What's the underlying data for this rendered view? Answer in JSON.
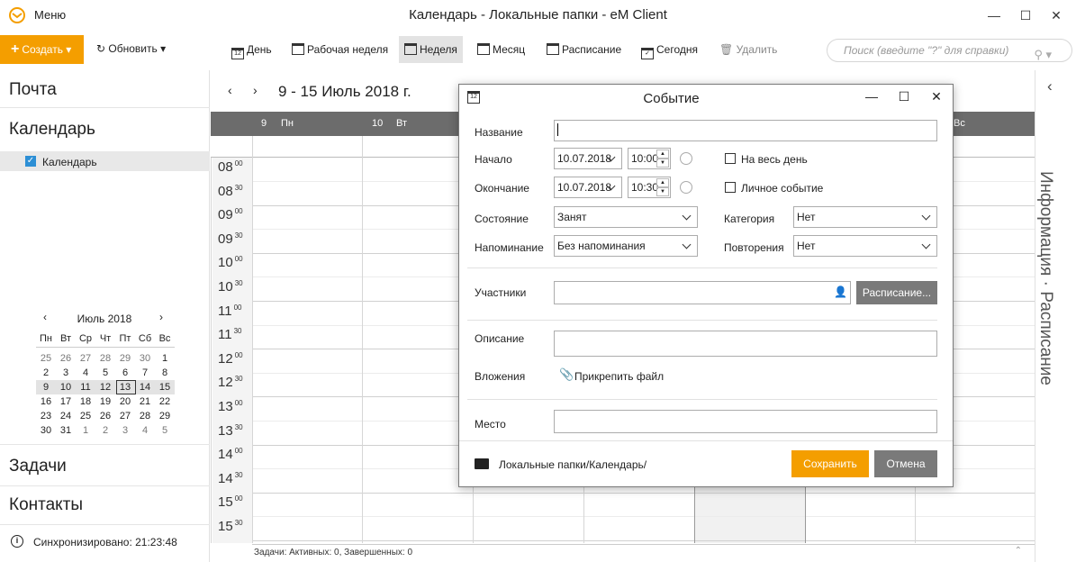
{
  "titlebar": {
    "menu": "Меню",
    "title": "Календарь - Локальные папки - eM Client",
    "min": "—",
    "max": "☐",
    "close": "✕"
  },
  "toolbar": {
    "create": "Создать",
    "refresh": "Обновить",
    "day": "День",
    "workweek": "Рабочая неделя",
    "week": "Неделя",
    "month": "Месяц",
    "schedule": "Расписание",
    "today": "Сегодня",
    "delete": "Удалить",
    "search_placeholder": "Поиск (введите \"?\" для справки)",
    "cal_icon_num": "12"
  },
  "sidebar": {
    "mail": "Почта",
    "calendar": "Календарь",
    "calendar_item": "Календарь",
    "tasks": "Задачи",
    "contacts": "Контакты",
    "sync": "Синхронизировано: 21:23:48"
  },
  "mini_calendar": {
    "title": "Июль 2018",
    "weekdays": [
      "Пн",
      "Вт",
      "Ср",
      "Чт",
      "Пт",
      "Сб",
      "Вс"
    ],
    "weeks": [
      [
        "25",
        "26",
        "27",
        "28",
        "29",
        "30",
        "1"
      ],
      [
        "2",
        "3",
        "4",
        "5",
        "6",
        "7",
        "8"
      ],
      [
        "9",
        "10",
        "11",
        "12",
        "13",
        "14",
        "15"
      ],
      [
        "16",
        "17",
        "18",
        "19",
        "20",
        "21",
        "22"
      ],
      [
        "23",
        "24",
        "25",
        "26",
        "27",
        "28",
        "29"
      ],
      [
        "30",
        "31",
        "1",
        "2",
        "3",
        "4",
        "5"
      ]
    ],
    "today": "13"
  },
  "calendar": {
    "range": "9 - 15 Июль 2018 г.",
    "days": [
      {
        "num": "9",
        "name": "Пн"
      },
      {
        "num": "10",
        "name": "Вт"
      },
      {
        "name": "Вс"
      }
    ],
    "hours": [
      "08",
      "08",
      "09",
      "09",
      "10",
      "10",
      "11",
      "11",
      "12",
      "12",
      "13",
      "13",
      "14",
      "14",
      "15",
      "15"
    ],
    "minutes": [
      "00",
      "30",
      "00",
      "30",
      "00",
      "30",
      "00",
      "30",
      "00",
      "30",
      "00",
      "30",
      "00",
      "30",
      "00",
      "30"
    ],
    "tasks_status": "Задачи: Активных: 0, Завершенных: 0"
  },
  "right_pane": {
    "text": "Информация  ·  Расписание"
  },
  "dialog": {
    "title": "Событие",
    "name_label": "Название",
    "name_value": "",
    "start_label": "Начало",
    "start_date": "10.07.2018",
    "start_time": "10:00",
    "end_label": "Окончание",
    "end_date": "10.07.2018",
    "end_time": "10:30",
    "allday_label": "На весь день",
    "private_label": "Личное событие",
    "status_label": "Состояние",
    "status_value": "Занят",
    "category_label": "Категория",
    "category_value": "Нет",
    "reminder_label": "Напоминание",
    "reminder_value": "Без напоминания",
    "repeat_label": "Повторения",
    "repeat_value": "Нет",
    "attendees_label": "Участники",
    "schedule_btn": "Расписание...",
    "description_label": "Описание",
    "attachments_label": "Вложения",
    "attach_btn": "Прикрепить файл",
    "location_label": "Место",
    "folder": "Локальные папки/Календарь/",
    "save": "Сохранить",
    "cancel": "Отмена"
  }
}
